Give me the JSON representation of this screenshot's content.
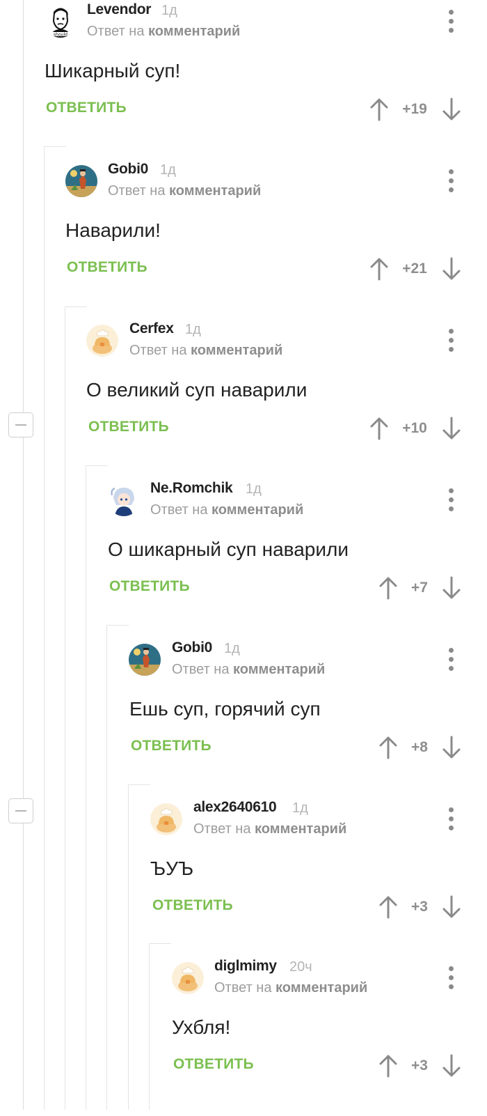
{
  "labels": {
    "reply_to_prefix": "Ответ на",
    "reply_to_link": "комментарий",
    "reply_button": "ОТВЕТИТЬ"
  },
  "comments": [
    {
      "user": "Levendor",
      "time": "1д",
      "text": "Шикарный суп!",
      "score": "+19",
      "avatar": "levendor-avatar"
    },
    {
      "user": "Gobi0",
      "time": "1д",
      "text": "Наварили!",
      "score": "+21",
      "avatar": "gobi-avatar"
    },
    {
      "user": "Cerfex",
      "time": "1д",
      "text": "О великий суп наварили",
      "score": "+10",
      "avatar": "default-chef-avatar"
    },
    {
      "user": "Ne.Romchik",
      "time": "1д",
      "text": "О шикарный суп наварили",
      "score": "+7",
      "avatar": "anime-avatar"
    },
    {
      "user": "Gobi0",
      "time": "1д",
      "text": "Ешь суп, горячий суп",
      "score": "+8",
      "avatar": "gobi-avatar"
    },
    {
      "user": "alex2640610",
      "time": "1д",
      "text": "ЪУЪ",
      "score": "+3",
      "avatar": "default-chef-avatar"
    },
    {
      "user": "diglmimy",
      "time": "20ч",
      "text": "Ухбля!",
      "score": "+3",
      "avatar": "default-chef-avatar"
    }
  ],
  "colors": {
    "reply_green": "#7bbf50",
    "meta_gray": "#9d9d9d",
    "line_gray": "#e4e4e4"
  }
}
